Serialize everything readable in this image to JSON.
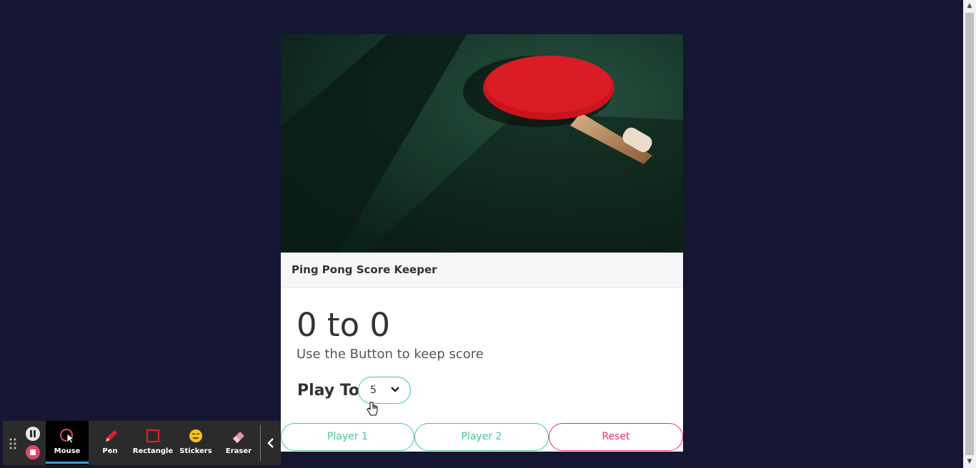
{
  "card": {
    "title": "Ping Pong Score Keeper",
    "score_text": "0 to 0",
    "hint": "Use the Button to keep score",
    "play_to_label": "Play To",
    "play_to_value": "5",
    "buttons": {
      "player1": "Player 1",
      "player2": "Player 2",
      "reset": "Reset"
    }
  },
  "toolbar": {
    "tools": [
      {
        "label": "Mouse",
        "icon": "mouse-cursor-icon",
        "active": true
      },
      {
        "label": "Pen",
        "icon": "pen-icon",
        "active": false
      },
      {
        "label": "Rectangle",
        "icon": "rectangle-icon",
        "active": false
      },
      {
        "label": "Stickers",
        "icon": "sticker-icon",
        "active": false
      },
      {
        "label": "Eraser",
        "icon": "eraser-icon",
        "active": false
      }
    ]
  },
  "colors": {
    "page_bg": "#151631",
    "accent_green": "#48c78e",
    "accent_pink": "#e3306a",
    "toolbar_bg": "#2b2b2b"
  }
}
